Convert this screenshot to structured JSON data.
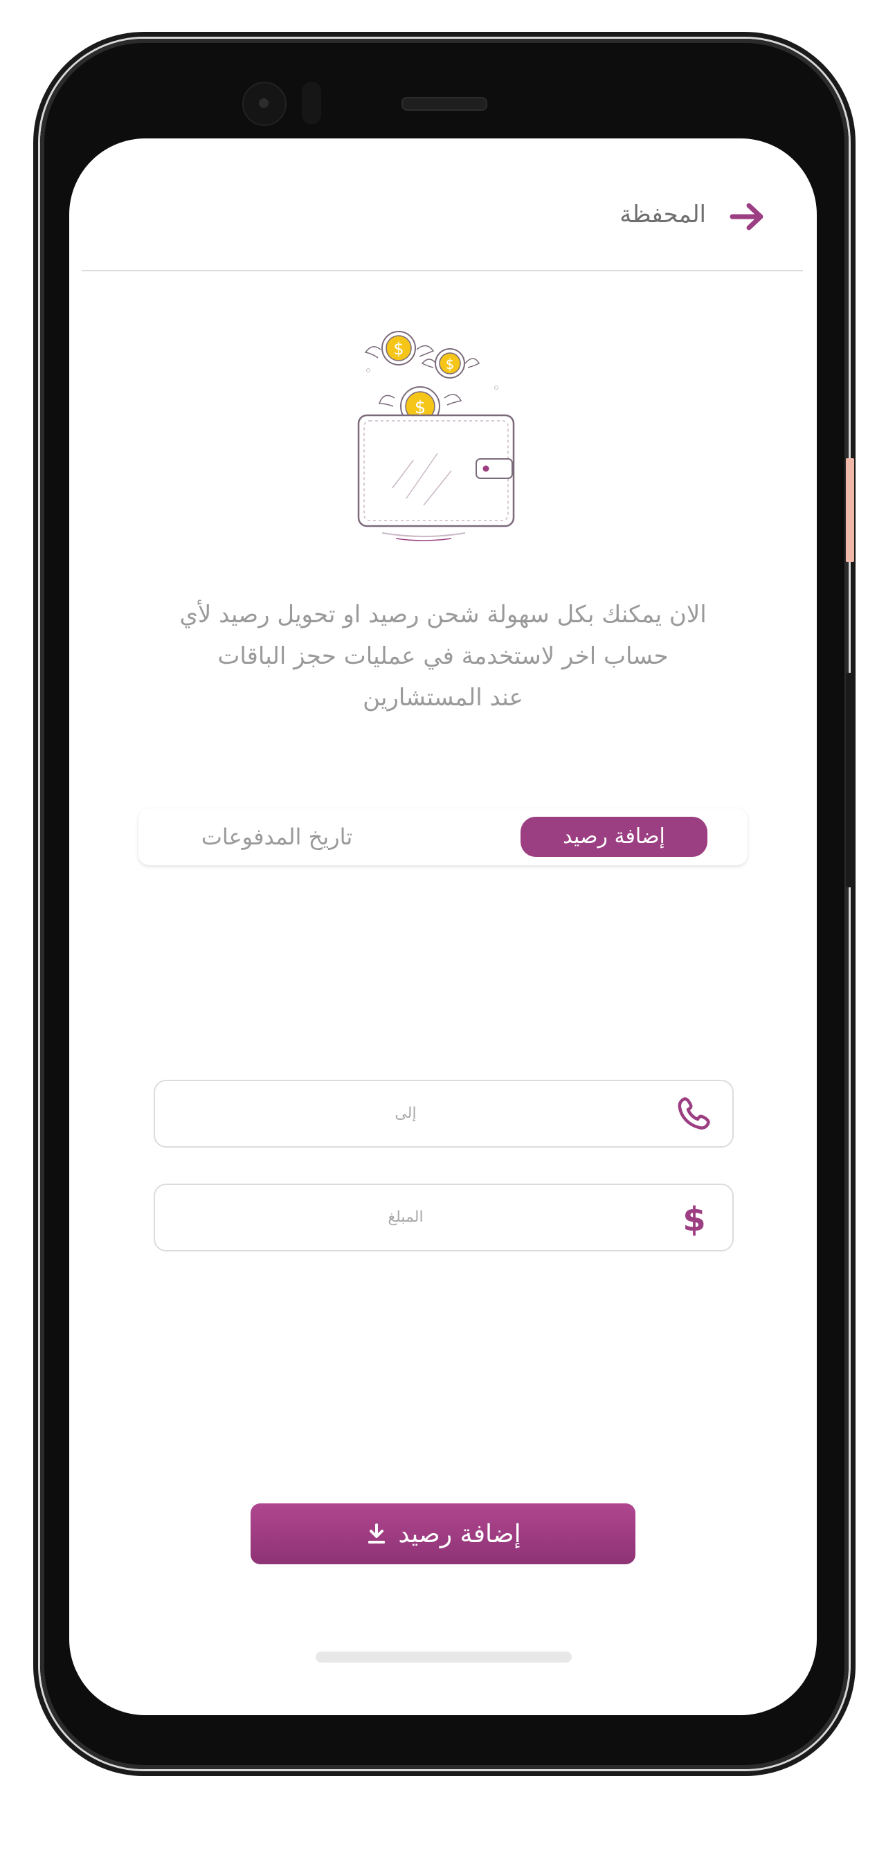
{
  "header": {
    "title": "المحفظة",
    "back_icon": "arrow-right-icon"
  },
  "illustration": {
    "icon": "wallet-flying-coins-illustration",
    "coin_symbol": "$"
  },
  "description": {
    "line1": "الان يمكنك بكل سهولة شحن  رصيد او تحويل رصيد لأي",
    "line2": "حساب اخر لاستخدمة في عمليات حجز الباقات",
    "line3": "عند المستشارين"
  },
  "tabs": {
    "active": "إضافة رصيد",
    "inactive": "تاريخ المدفوعات"
  },
  "form": {
    "recipient": {
      "placeholder": "إلى",
      "icon": "phone-icon",
      "value": ""
    },
    "amount": {
      "placeholder": "المبلغ",
      "icon": "dollar-icon",
      "value": ""
    }
  },
  "submit": {
    "label": "إضافة رصيد",
    "icon": "download-icon"
  },
  "colors": {
    "accent": "#9c3e82",
    "text_muted": "#9a9a9a",
    "coin": "#f5c518"
  }
}
